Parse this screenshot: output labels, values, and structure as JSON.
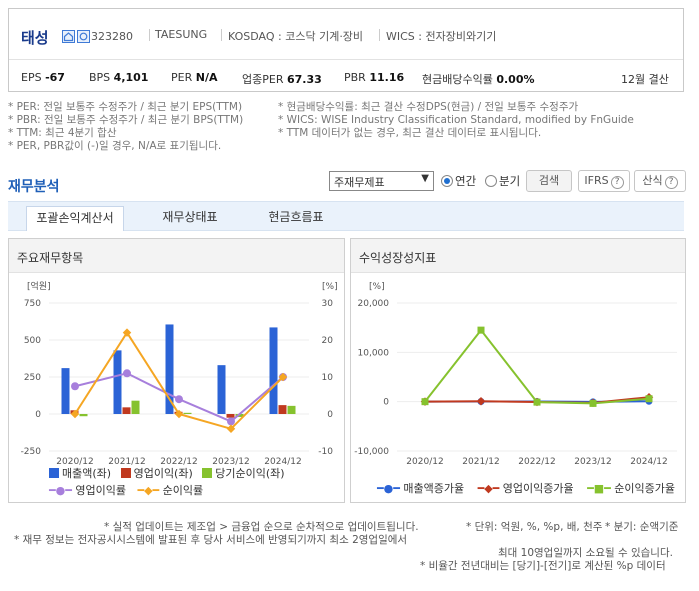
{
  "company": {
    "name": "태성",
    "code": "323280",
    "english": "TAESUNG",
    "market": "KOSDAQ : 코스닥 기계·장비",
    "wics": "WICS : 전자장비와기기"
  },
  "metrics": {
    "eps_label": "EPS",
    "eps": "-67",
    "bps_label": "BPS",
    "bps": "4,101",
    "per_label": "PER",
    "per": "N/A",
    "sector_per_label": "업종PER",
    "sector_per": "67.33",
    "pbr_label": "PBR",
    "pbr": "11.16",
    "dividend_label": "현금배당수익률",
    "dividend": "0.00%",
    "fiscal": "12월 결산"
  },
  "notes": {
    "per": "* PER: 전일 보통주 수정주가 / 최근 분기 EPS(TTM)",
    "pbr": "* PBR: 전일 보통주 수정주가 / 최근 분기 BPS(TTM)",
    "ttm": "* TTM: 최근 4분기 합산",
    "na": "* PER, PBR값이 (-)일 경우, N/A로 표기됩니다.",
    "div": "* 현금배당수익률: 최근 결산 수정DPS(현금) / 전일 보통주 수정주가",
    "wics": "* WICS: WISE Industry Classification Standard, modified by FnGuide",
    "ttm_none": "* TTM 데이터가 없는 경우, 최근 결산 데이터로 표시됩니다."
  },
  "section_title": "재무분석",
  "controls": {
    "select": "주재무제표",
    "radio_annual": "연간",
    "radio_quarter": "분기",
    "search": "검색",
    "ifrs": "IFRS",
    "formula": "산식",
    "qmark": "?"
  },
  "tabs": [
    "포괄손익계산서",
    "재무상태표",
    "현금흐름표"
  ],
  "panels": {
    "left_title": "주요재무항목",
    "right_title": "수익성장성지표"
  },
  "chart_data": [
    {
      "type": "bar",
      "title": "주요재무항목",
      "left_unit": "[억원]",
      "right_unit": "[%]",
      "categories": [
        "2020/12",
        "2021/12",
        "2022/12",
        "2023/12",
        "2024/12"
      ],
      "ylim_left": [
        -250,
        750
      ],
      "yticks_left": [
        -250,
        0,
        250,
        500,
        750
      ],
      "ylim_right": [
        -10,
        30
      ],
      "yticks_right": [
        -10,
        0,
        10,
        20,
        30
      ],
      "series": [
        {
          "name": "매출액(좌)",
          "kind": "bar",
          "axis": "left",
          "color": "#2b63d6",
          "values": [
            310,
            430,
            605,
            330,
            585
          ]
        },
        {
          "name": "영업이익(좌)",
          "kind": "bar",
          "axis": "left",
          "color": "#c0391f",
          "values": [
            25,
            45,
            15,
            -25,
            60
          ]
        },
        {
          "name": "당기순이익(좌)",
          "kind": "bar",
          "axis": "left",
          "color": "#86c22e",
          "values": [
            -15,
            90,
            8,
            -20,
            55
          ]
        },
        {
          "name": "영업이익률",
          "kind": "line",
          "axis": "right",
          "color": "#a77fdc",
          "values": [
            7.5,
            11,
            4,
            -2,
            10
          ]
        },
        {
          "name": "순이익률",
          "kind": "line",
          "axis": "right",
          "color": "#f5a623",
          "values": [
            0,
            22,
            0,
            -4,
            10
          ]
        }
      ]
    },
    {
      "type": "line",
      "title": "수익성장성지표",
      "unit": "[%]",
      "categories": [
        "2020/12",
        "2021/12",
        "2022/12",
        "2023/12",
        "2024/12"
      ],
      "ylim": [
        -10000,
        20000
      ],
      "yticks": [
        -10000,
        0,
        10000,
        20000
      ],
      "ytick_labels": [
        "-10,000",
        "0",
        "10,000",
        "20,000"
      ],
      "series": [
        {
          "name": "매출액증가율",
          "color": "#2b63d6",
          "values": [
            0,
            40,
            40,
            -45,
            77
          ]
        },
        {
          "name": "영업이익증가율",
          "color": "#c0391f",
          "values": [
            0,
            80,
            -65,
            -250,
            900
          ]
        },
        {
          "name": "순이익증가율",
          "color": "#86c22e",
          "values": [
            0,
            14500,
            -90,
            -350,
            600
          ]
        }
      ]
    }
  ],
  "footer": {
    "line1": "* 실적 업데이트는 제조업 > 금융업 순으로 순차적으로 업데이트됩니다.",
    "line1b": "* 단위: 억원, %, %p, 배, 천주",
    "line1c": "* 분기: 순액기준",
    "line2": "* 재무 정보는 전자공시시스템에 발표된 후 당사 서비스에 반영되기까지 최소 2영업일에서",
    "line3": "최대 10영업일까지 소요될 수 있습니다.",
    "line4": "* 비율간 전년대비는 [당기]-[전기]로 계산된 %p 데이터"
  }
}
